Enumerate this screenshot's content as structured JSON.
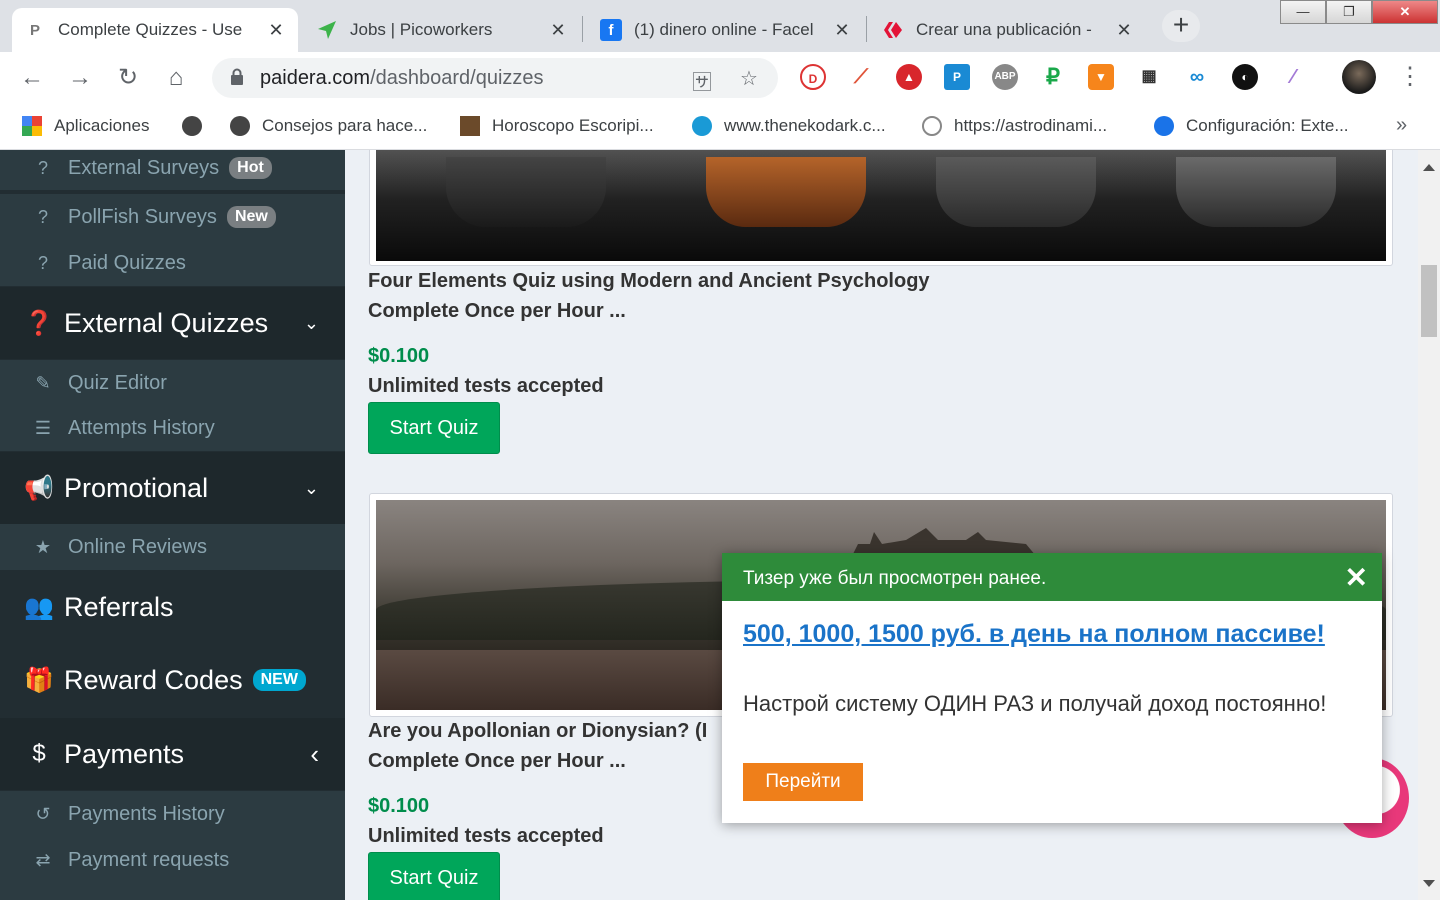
{
  "browser": {
    "tabs": [
      {
        "title": "Complete Quizzes - Use",
        "favicon": "P",
        "active": true
      },
      {
        "title": "Jobs | Picoworkers",
        "favicon": "picoworkers-icon",
        "active": false
      },
      {
        "title": "(1) dinero online - Facel",
        "favicon": "f",
        "active": false
      },
      {
        "title": "Crear una publicación -",
        "favicon": "hive-icon",
        "active": false
      }
    ],
    "new_tab": "+",
    "window_controls": {
      "minimize": "—",
      "restore": "❐",
      "close": "✕"
    },
    "url_host": "paidera.com",
    "url_path": "/dashboard/quizzes",
    "bookmarks": [
      {
        "label": "Aplicaciones"
      },
      {
        "label": ""
      },
      {
        "label": "Consejos para hace..."
      },
      {
        "label": "Horoscopo Escoripi..."
      },
      {
        "label": "www.thenekodark.c..."
      },
      {
        "label": "https://astrodinami..."
      },
      {
        "label": "Configuración: Exte..."
      }
    ],
    "bookmarks_overflow": "»"
  },
  "sidebar": {
    "surveys": [
      {
        "label": "External Surveys",
        "badge": "Hot"
      },
      {
        "label": "PollFish Surveys",
        "badge": "New"
      },
      {
        "label": "Paid Quizzes",
        "badge": ""
      }
    ],
    "external_quizzes": {
      "label": "External Quizzes",
      "chevron": "⌄"
    },
    "external_quizzes_items": [
      {
        "label": "Quiz Editor"
      },
      {
        "label": "Attempts History"
      }
    ],
    "promotional": {
      "label": "Promotional",
      "chevron": "⌄"
    },
    "promotional_items": [
      {
        "label": "Online Reviews"
      }
    ],
    "referrals": {
      "label": "Referrals"
    },
    "reward_codes": {
      "label": "Reward Codes",
      "badge": "NEW"
    },
    "payments": {
      "label": "Payments",
      "chevron": "‹"
    },
    "payments_items": [
      {
        "label": "Payments History"
      },
      {
        "label": "Payment requests"
      }
    ]
  },
  "quizzes": [
    {
      "title": "Four Elements Quiz using Modern and Ancient Psychology",
      "frequency": "Complete Once per Hour ...",
      "price": "$0.100",
      "tests": "Unlimited tests accepted",
      "button": "Start Quiz"
    },
    {
      "title": "Are you Apollonian or Dionysian? (I",
      "frequency": "Complete Once per Hour ...",
      "price": "$0.100",
      "tests": "Unlimited tests accepted",
      "button": "Start Quiz"
    }
  ],
  "popup": {
    "header": "Тизер уже был просмотрен ранее.",
    "close": "✕",
    "link": "500, 1000, 1500 руб. в день на полном пассиве!",
    "text": "Настрой систему ОДИН РАЗ и получай доход постоянно!",
    "button": "Перейти"
  },
  "colors": {
    "sidebar_bg": "#222d32",
    "sidebar_sub_bg": "#2c3b41",
    "accent_green": "#00a65a",
    "price_green": "#008d4c",
    "badge_new": "#00a7d0",
    "popup_header": "#2e8b3a",
    "popup_button": "#ef7f1a"
  }
}
